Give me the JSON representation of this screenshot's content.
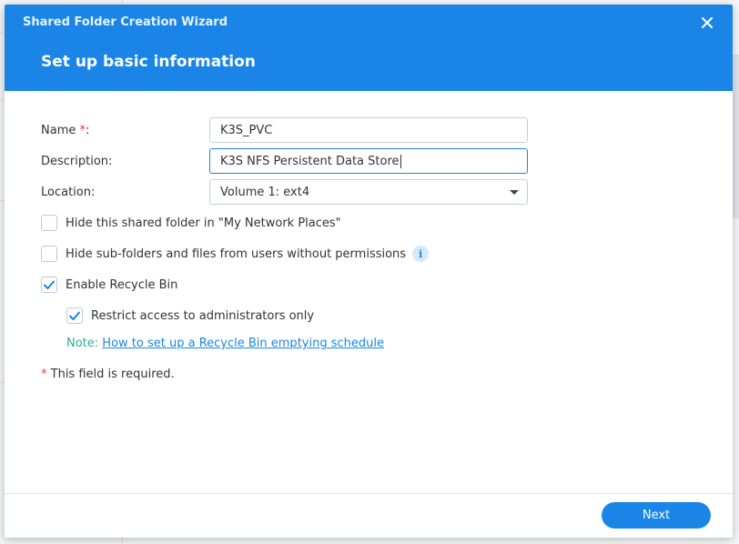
{
  "dialog": {
    "window_title": "Shared Folder Creation Wizard",
    "step_title": "Set up basic information",
    "close_icon": "close-icon"
  },
  "form": {
    "name_label": "Name",
    "name_required_mark": "*",
    "name_colon": ":",
    "name_value": "K3S_PVC",
    "description_label": "Description:",
    "description_value": "K3S NFS Persistent Data Store",
    "location_label": "Location:",
    "location_value": "Volume 1:  ext4"
  },
  "options": {
    "hide_folder": {
      "label": "Hide this shared folder in \"My Network Places\"",
      "checked": false
    },
    "hide_subfolders": {
      "label": "Hide sub-folders and files from users without permissions",
      "checked": false,
      "info_icon": "info-icon"
    },
    "enable_recycle_bin": {
      "label": "Enable Recycle Bin",
      "checked": true
    },
    "restrict_access": {
      "label": "Restrict access to administrators only",
      "checked": true
    }
  },
  "note": {
    "label": "Note:",
    "link_text": "How to set up a Recycle Bin emptying schedule"
  },
  "required_note": {
    "mark": "*",
    "text": "This field is required."
  },
  "footer": {
    "next_label": "Next"
  },
  "colors": {
    "accent": "#1a85e6",
    "required": "#e53935",
    "note": "#2bae9b"
  }
}
